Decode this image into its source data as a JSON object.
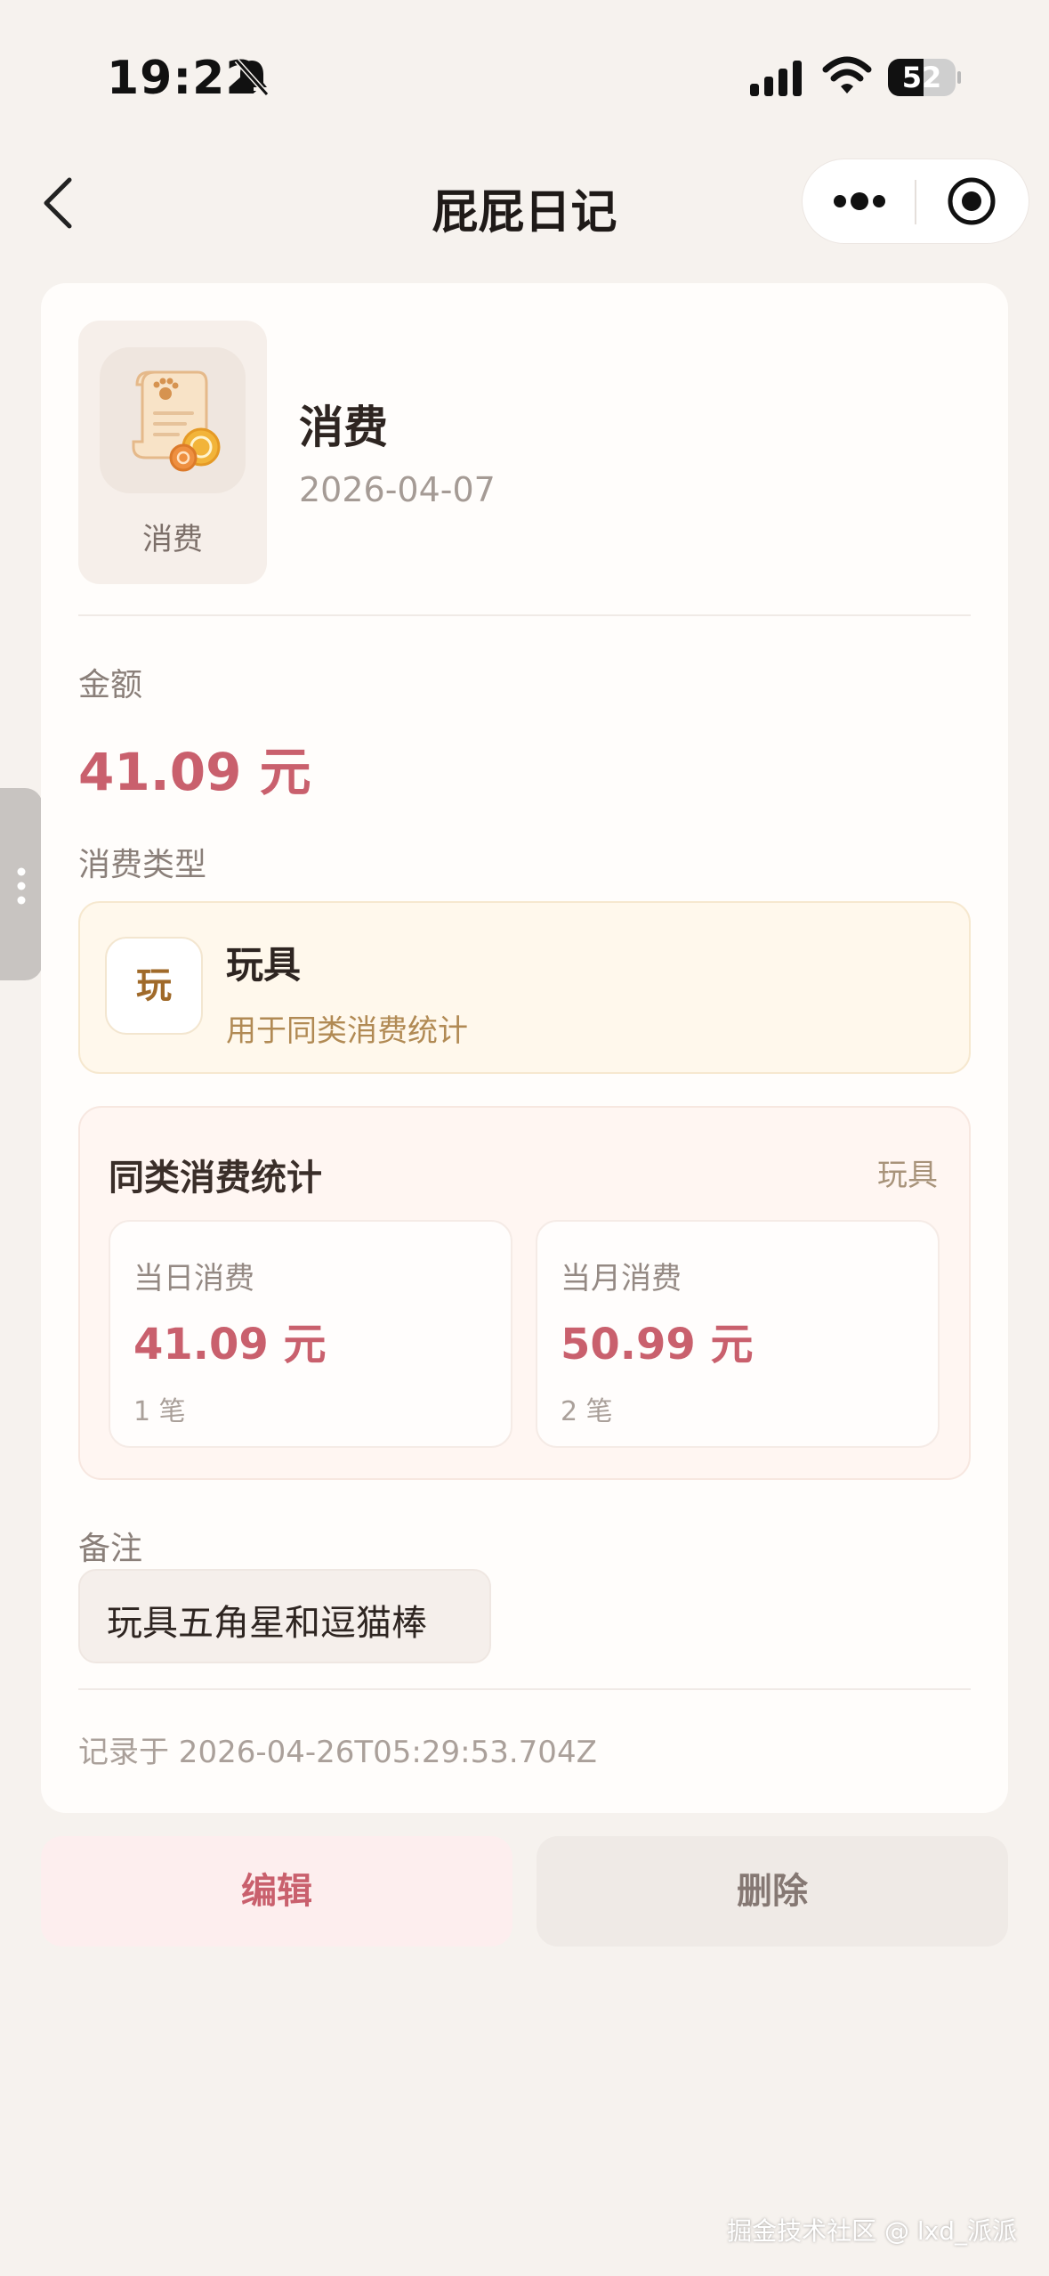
{
  "status_bar": {
    "time": "19:22",
    "battery": "52",
    "battery_level_percent": 52,
    "icons": [
      "bell-slash-icon",
      "cellular-signal-icon",
      "wifi-icon",
      "battery-icon"
    ]
  },
  "nav": {
    "title": "屁屁日记",
    "back_icon": "chevron-left-icon",
    "more_icon": "more-dots-icon",
    "close_icon": "target-circle-icon"
  },
  "record": {
    "category_icon": "receipt-coin-icon",
    "category_label": "消费",
    "title": "消费",
    "date": "2026-04-07"
  },
  "amount": {
    "label": "金额",
    "value": "41.09 元"
  },
  "type": {
    "label": "消费类型",
    "icon_text": "玩",
    "name": "玩具",
    "subtitle": "用于同类消费统计"
  },
  "stats": {
    "title": "同类消费统计",
    "tag": "玩具",
    "day": {
      "label": "当日消费",
      "value": "41.09 元",
      "count": "1 笔"
    },
    "month": {
      "label": "当月消费",
      "value": "50.99 元",
      "count": "2 笔"
    }
  },
  "note": {
    "label": "备注",
    "text": "玩具五角星和逗猫棒"
  },
  "recorded_at": "记录于 2026-04-26T05:29:53.704Z",
  "actions": {
    "edit": "编辑",
    "delete": "删除"
  },
  "watermark": "掘金技术社区 @ lxd_派派",
  "colors": {
    "accent": "#c9606d",
    "background": "#f6f2ee",
    "card": "#fffdfb",
    "type_bg": "#fff8ec",
    "stats_bg": "#fff6f2"
  }
}
